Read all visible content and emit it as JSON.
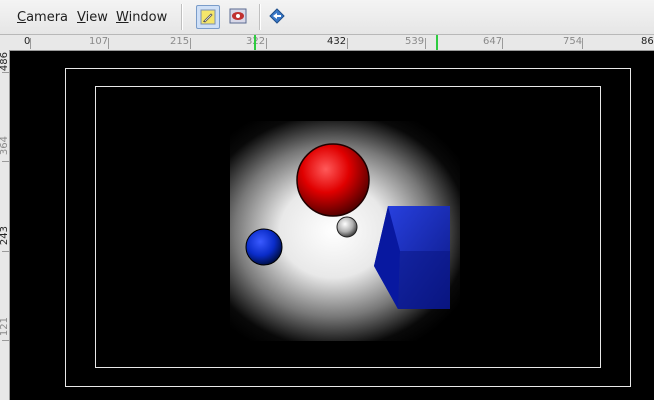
{
  "menu": {
    "items": [
      {
        "mnemonic": "C",
        "rest": "amera"
      },
      {
        "mnemonic": "V",
        "rest": "iew"
      },
      {
        "mnemonic": "W",
        "rest": "indow"
      }
    ]
  },
  "toolbar": {
    "buttons": [
      {
        "icon": "pencil-icon",
        "active": true
      },
      {
        "icon": "eye-icon",
        "active": false
      },
      {
        "icon": "diamond-arrow-icon",
        "active": false
      }
    ]
  },
  "ruler": {
    "top_labels": [
      "0",
      "107",
      "215",
      "322",
      "432",
      "539",
      "647",
      "754",
      "86"
    ],
    "left_labels": [
      "486",
      "364",
      "243",
      "121"
    ]
  },
  "scene": {
    "objects": [
      "red-sphere",
      "white-sphere",
      "blue-sphere",
      "blue-cube",
      "light-glow"
    ],
    "colors": {
      "red": "#e00000",
      "blue": "#0a2cc8",
      "background": "#000000",
      "frame": "#e8e8e8"
    }
  }
}
